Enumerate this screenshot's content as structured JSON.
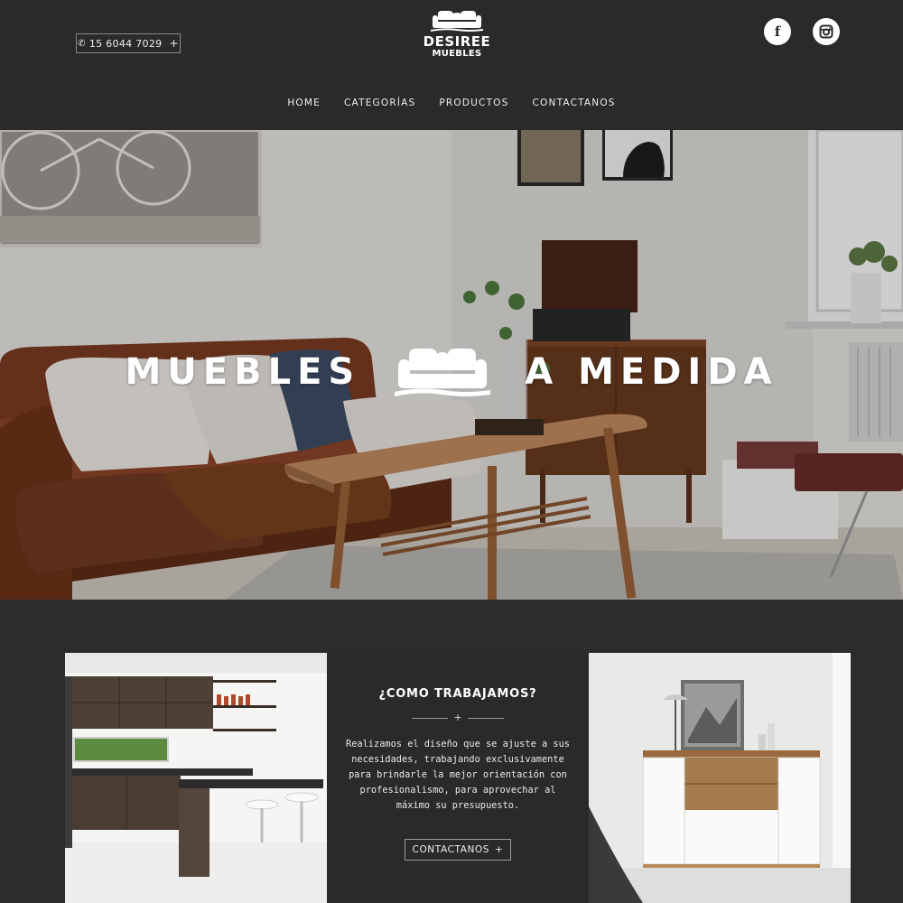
{
  "header": {
    "phone": {
      "label": "15 6044 7029",
      "icon": "phone-icon",
      "plus": "+"
    },
    "logo": {
      "line1": "DESIREE",
      "line2": "MUEBLES",
      "icon": "sofa-icon"
    },
    "social": [
      {
        "name": "facebook-icon",
        "glyph": "f"
      },
      {
        "name": "instagram-icon"
      }
    ],
    "nav": [
      "HOME",
      "CATEGORÍAS",
      "PRODUCTOS",
      "CONTACTANOS"
    ]
  },
  "hero": {
    "title_left": "MUEBLES",
    "title_right": "A MEDIDA",
    "icon": "sofa-icon"
  },
  "feature": {
    "title": "¿COMO TRABAJAMOS?",
    "divider_plus": "+",
    "body": "Realizamos el diseño que se ajuste a sus necesidades, trabajando exclusivamente para brindarle la mejor orientación con profesionalismo, para aprovechar al máximo su presupuesto.",
    "cta_label": "CONTACTANOS",
    "cta_plus": "+"
  },
  "colors": {
    "background": "#2c2c2c",
    "header": "#2a2a2a",
    "text": "#ffffff",
    "border": "#8a8a8a"
  }
}
